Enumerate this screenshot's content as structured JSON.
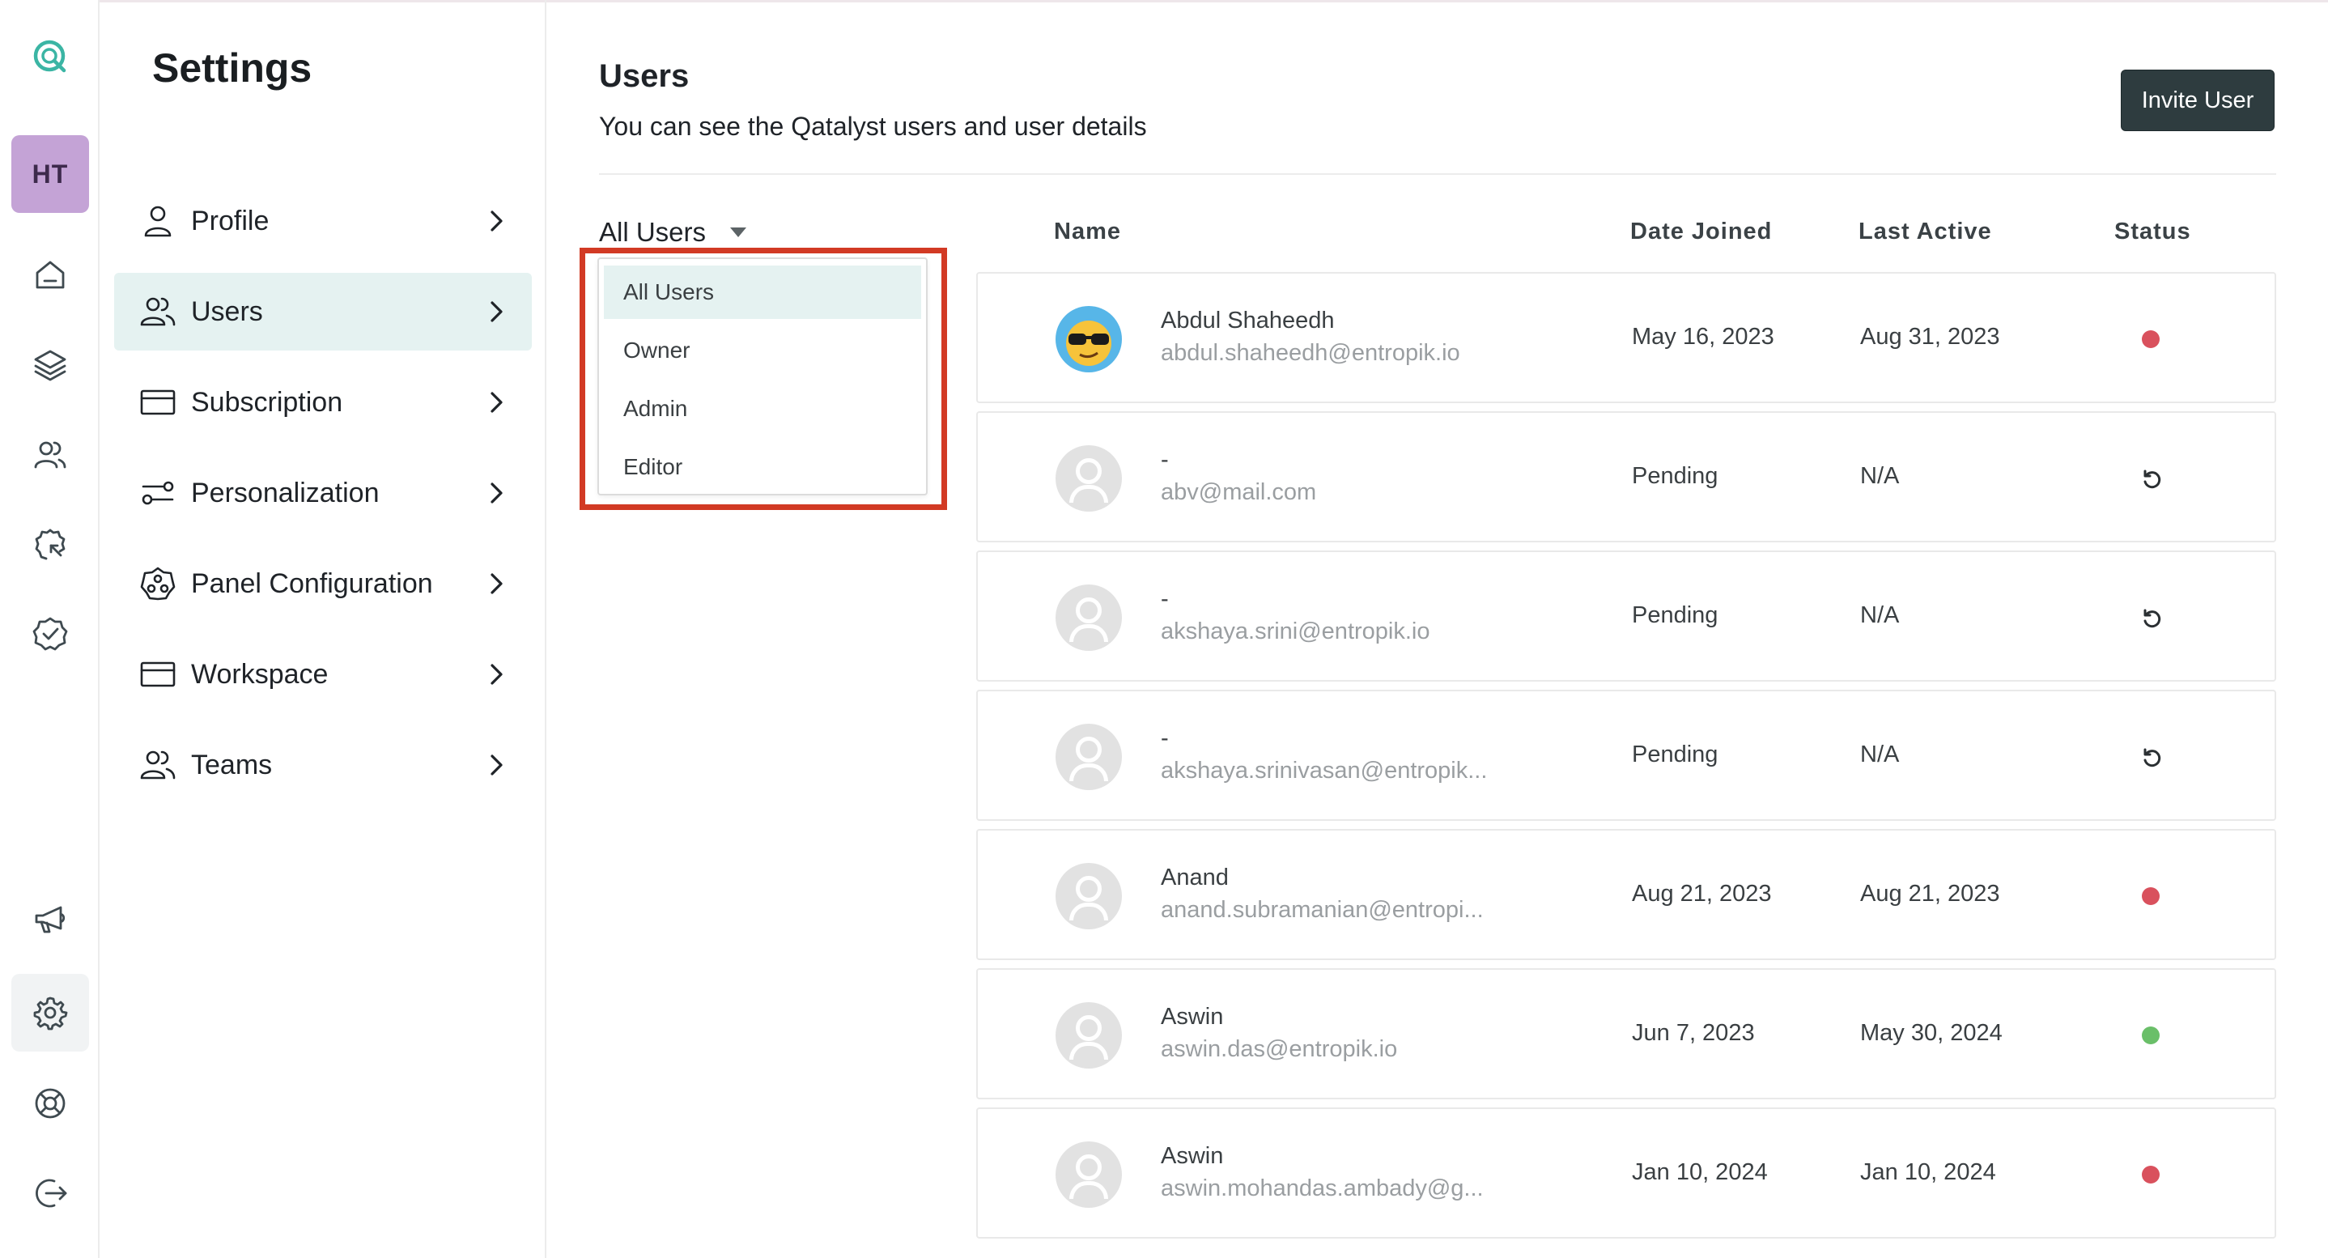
{
  "settings": {
    "title": "Settings",
    "menu": [
      {
        "label": "Profile",
        "icon": "user-icon",
        "active": false
      },
      {
        "label": "Users",
        "icon": "users-icon",
        "active": true
      },
      {
        "label": "Subscription",
        "icon": "card-icon",
        "active": false
      },
      {
        "label": "Personalization",
        "icon": "toggle-icon",
        "active": false
      },
      {
        "label": "Panel Configuration",
        "icon": "panel-icon",
        "active": false
      },
      {
        "label": "Workspace",
        "icon": "card-icon",
        "active": false
      },
      {
        "label": "Teams",
        "icon": "users-icon",
        "active": false
      }
    ]
  },
  "rail": {
    "avatar_initials": "HT",
    "avatar_color": "#c4a3d6"
  },
  "main": {
    "title": "Users",
    "subtitle": "You can see the Qatalyst users and user details",
    "invite_label": "Invite User",
    "filter": {
      "selected": "All Users",
      "options": [
        "All Users",
        "Owner",
        "Admin",
        "Editor"
      ]
    },
    "columns": {
      "name": "Name",
      "date_joined": "Date Joined",
      "last_active": "Last Active",
      "status": "Status"
    },
    "rows": [
      {
        "name": "Abdul Shaheedh",
        "email": "abdul.shaheedh@entropik.io",
        "date_joined": "May 16, 2023",
        "last_active": "Aug 31, 2023",
        "status": "inactive"
      },
      {
        "name": "-",
        "email": "abv@mail.com",
        "date_joined": "Pending",
        "last_active": "N/A",
        "status": "pending"
      },
      {
        "name": "-",
        "email": "akshaya.srini@entropik.io",
        "date_joined": "Pending",
        "last_active": "N/A",
        "status": "pending"
      },
      {
        "name": "-",
        "email": "akshaya.srinivasan@entropik...",
        "date_joined": "Pending",
        "last_active": "N/A",
        "status": "pending"
      },
      {
        "name": "Anand",
        "email": "anand.subramanian@entropi...",
        "date_joined": "Aug 21, 2023",
        "last_active": "Aug 21, 2023",
        "status": "inactive"
      },
      {
        "name": "Aswin",
        "email": "aswin.das@entropik.io",
        "date_joined": "Jun 7, 2023",
        "last_active": "May 30, 2024",
        "status": "active"
      },
      {
        "name": "Aswin",
        "email": "aswin.mohandas.ambady@g...",
        "date_joined": "Jan 10, 2024",
        "last_active": "Jan 10, 2024",
        "status": "inactive"
      }
    ]
  },
  "colors": {
    "accent": "#3bb5a4",
    "active_dot": "#6abf69",
    "inactive_dot": "#d9515d",
    "button_bg": "#2e3c3f",
    "highlight_box": "#d23a24",
    "selected_bg": "#e5f2f1"
  }
}
